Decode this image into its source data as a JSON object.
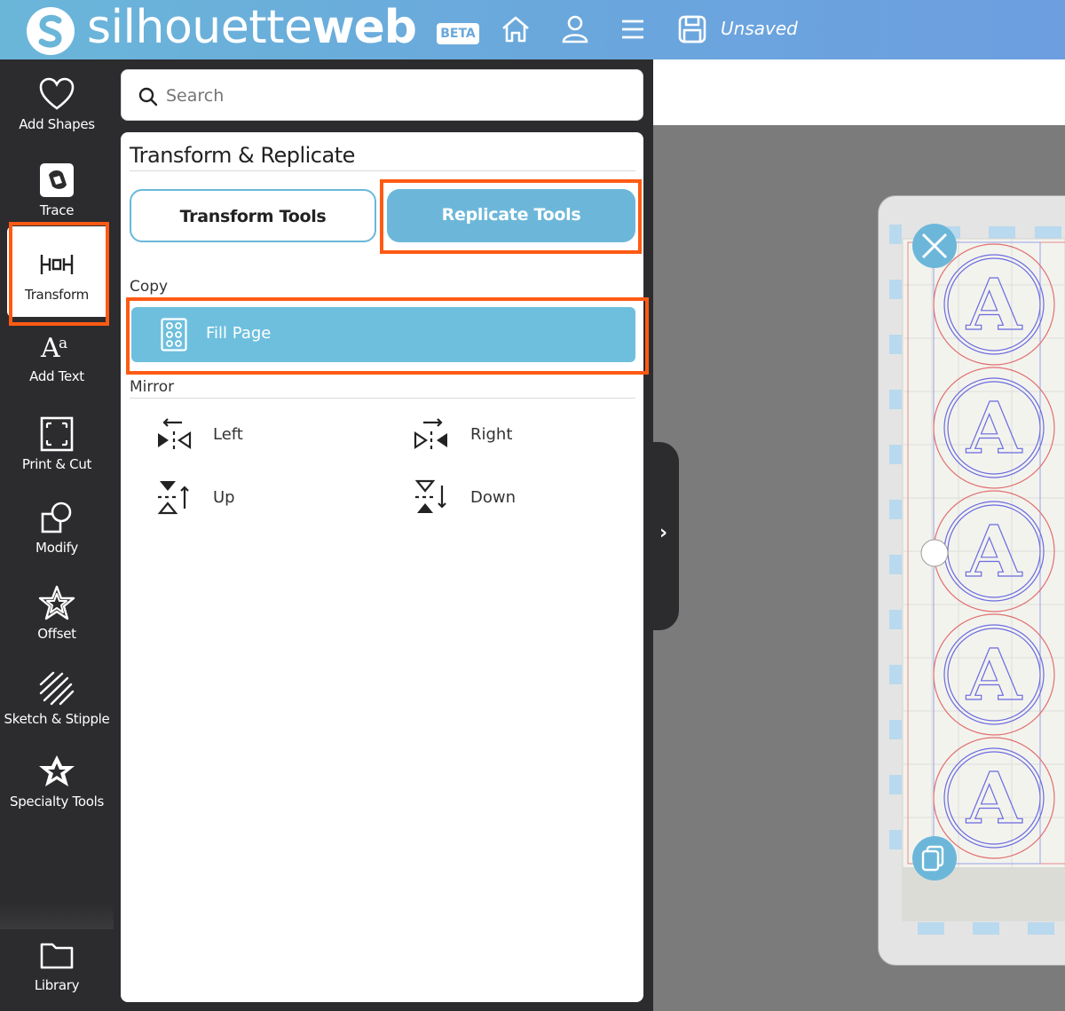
{
  "header": {
    "logo_text_regular": "silhouette",
    "logo_text_bold": "web",
    "beta_badge": "BETA",
    "save_status": "Unsaved",
    "icons": [
      "home-icon",
      "user-icon",
      "menu-icon",
      "save-icon"
    ]
  },
  "sidebar": {
    "items": [
      {
        "label": "Add Shapes",
        "icon": "heart-icon"
      },
      {
        "label": "Trace",
        "icon": "trace-icon"
      },
      {
        "label": "Transform",
        "icon": "transform-icon",
        "active": true
      },
      {
        "label": "Add Text",
        "icon": "text-icon"
      },
      {
        "label": "Print & Cut",
        "icon": "print-cut-icon"
      },
      {
        "label": "Modify",
        "icon": "modify-icon"
      },
      {
        "label": "Offset",
        "icon": "offset-icon"
      },
      {
        "label": "Sketch & Stipple",
        "icon": "sketch-icon"
      },
      {
        "label": "Specialty Tools",
        "icon": "star-badge-icon"
      }
    ],
    "library": {
      "label": "Library",
      "icon": "folder-icon"
    }
  },
  "search": {
    "placeholder": "Search"
  },
  "panel": {
    "title": "Transform & Replicate",
    "tabs": [
      {
        "label": "Transform Tools",
        "selected": false
      },
      {
        "label": "Replicate Tools",
        "selected": true
      }
    ],
    "copy": {
      "heading": "Copy",
      "fill_page_label": "Fill Page"
    },
    "mirror": {
      "heading": "Mirror",
      "left": "Left",
      "right": "Right",
      "up": "Up",
      "down": "Down"
    }
  },
  "canvas": {
    "letter": "A",
    "copies": 5,
    "accent": "#6cb7d9",
    "highlight": "#ff5a14"
  }
}
